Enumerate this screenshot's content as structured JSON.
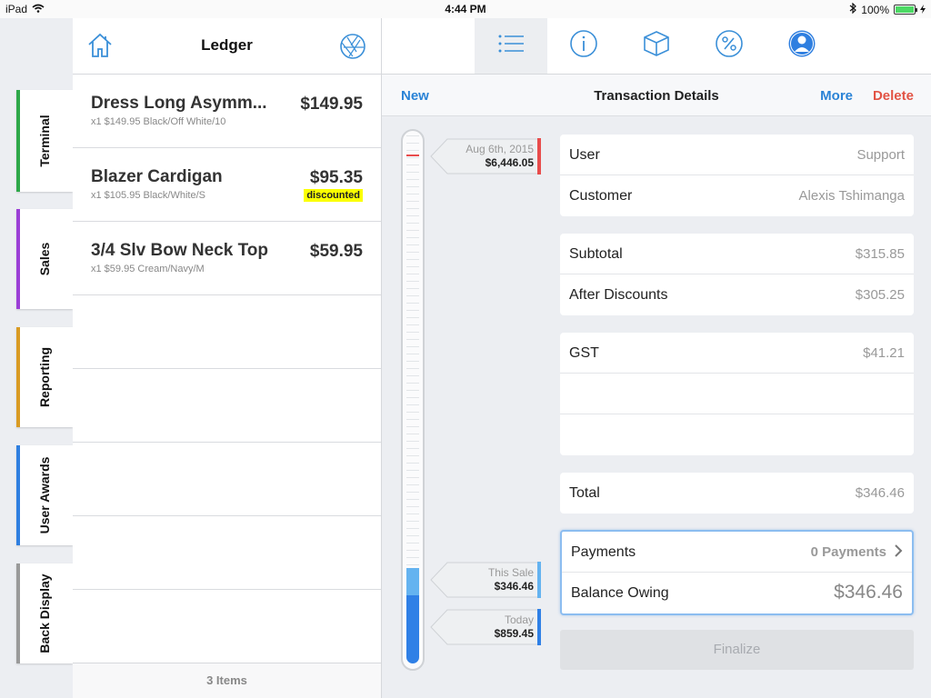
{
  "status_bar": {
    "device": "iPad",
    "time": "4:44 PM",
    "battery": "100%",
    "battery_level": 1.0
  },
  "side_tabs": [
    {
      "label": "Terminal",
      "color": "#2ea84a"
    },
    {
      "label": "Sales",
      "color": "#9b3fd6"
    },
    {
      "label": "Reporting",
      "color": "#d99b24"
    },
    {
      "label": "User Awards",
      "color": "#2f7fe0"
    },
    {
      "label": "Back Display",
      "color": "#9a9a9a"
    }
  ],
  "ledger": {
    "title": "Ledger",
    "items": [
      {
        "name": "Dress Long Asymm...",
        "details": "x1  $149.95  Black/Off White/10",
        "price": "$149.95",
        "badge": ""
      },
      {
        "name": "Blazer Cardigan",
        "details": "x1  $105.95  Black/White/S",
        "price": "$95.35",
        "badge": "discounted"
      },
      {
        "name": "3/4 Slv Bow Neck Top",
        "details": "x1  $59.95  Cream/Navy/M",
        "price": "$59.95",
        "badge": ""
      }
    ],
    "footer": "3 Items"
  },
  "toolbar": {
    "icons": [
      "list-icon",
      "info-icon",
      "box-icon",
      "percent-icon",
      "user-icon"
    ],
    "active": "list-icon"
  },
  "transaction": {
    "new_label": "New",
    "title": "Transaction Details",
    "more_label": "More",
    "delete_label": "Delete",
    "user_label": "User",
    "user_value": "Support",
    "customer_label": "Customer",
    "customer_value": "Alexis Tshimanga",
    "subtotal_label": "Subtotal",
    "subtotal_value": "$315.85",
    "after_discounts_label": "After Discounts",
    "after_discounts_value": "$305.25",
    "gst_label": "GST",
    "gst_value": "$41.21",
    "total_label": "Total",
    "total_value": "$346.46",
    "payments_label": "Payments",
    "payments_value": "0 Payments",
    "balance_label": "Balance Owing",
    "balance_value": "$346.46",
    "finalize_label": "Finalize"
  },
  "timeline": {
    "flags": [
      {
        "label": "Aug 6th, 2015",
        "amount": "$6,446.05",
        "color": "#e84c4c"
      },
      {
        "label": "This Sale",
        "amount": "$346.46",
        "color": "#64b3f0"
      },
      {
        "label": "Today",
        "amount": "$859.45",
        "color": "#2f80e6"
      }
    ]
  },
  "colors": {
    "accent": "#2a83d6",
    "danger": "#e25344"
  }
}
